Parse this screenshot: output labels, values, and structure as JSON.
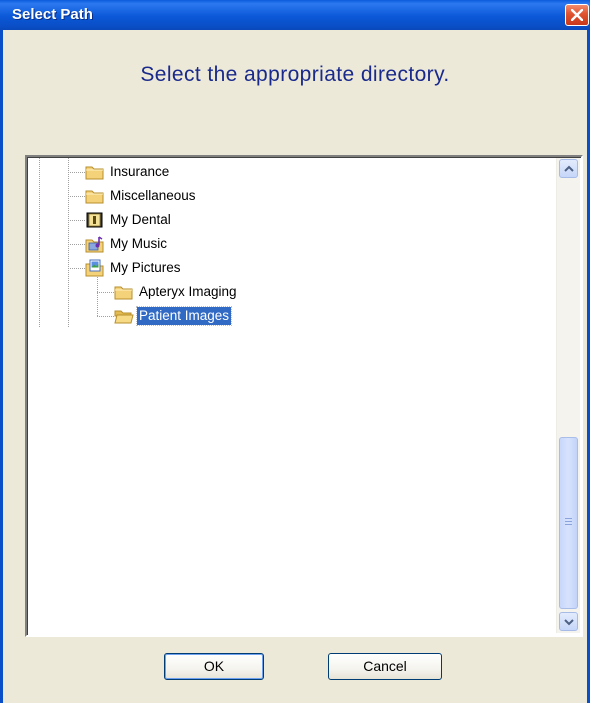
{
  "window": {
    "title": "Select Path"
  },
  "dialog": {
    "heading": "Select the appropriate directory."
  },
  "tree": {
    "items": [
      {
        "label": "Insurance",
        "icon": "folder-icon"
      },
      {
        "label": "Miscellaneous",
        "icon": "folder-icon"
      },
      {
        "label": "My Dental",
        "icon": "dental-folder-icon"
      },
      {
        "label": "My Music",
        "icon": "music-folder-icon"
      },
      {
        "label": "My Pictures",
        "icon": "pictures-folder-icon"
      },
      {
        "label": "Apteryx Imaging",
        "icon": "folder-icon"
      },
      {
        "label": "Patient Images",
        "icon": "open-folder-icon",
        "selected": true
      }
    ]
  },
  "buttons": {
    "ok_label": "OK",
    "cancel_label": "Cancel"
  },
  "colors": {
    "title_bar": "#0a5bdc",
    "heading_text": "#1a2a8c",
    "selection": "#316ac5",
    "dialog_bg": "#ece9d8"
  }
}
